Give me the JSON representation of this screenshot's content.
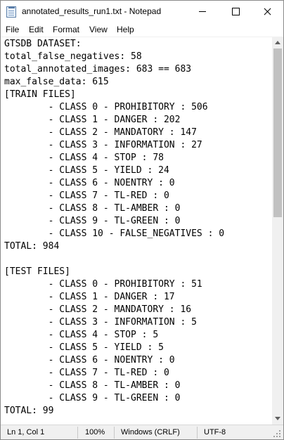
{
  "window": {
    "title": "annotated_results_run1.txt - Notepad",
    "app_icon": "notepad-icon",
    "controls": [
      "minimize-icon",
      "maximize-icon",
      "close-icon"
    ]
  },
  "menu": {
    "items": [
      "File",
      "Edit",
      "Format",
      "View",
      "Help"
    ]
  },
  "editor": {
    "lines": [
      "GTSDB DATASET:",
      "total_false_negatives: 58",
      "total_annotated_images: 683 == 683",
      "max_false_data: 615",
      "[TRAIN FILES]",
      "        - CLASS 0 - PROHIBITORY : 506",
      "        - CLASS 1 - DANGER : 202",
      "        - CLASS 2 - MANDATORY : 147",
      "        - CLASS 3 - INFORMATION : 27",
      "        - CLASS 4 - STOP : 78",
      "        - CLASS 5 - YIELD : 24",
      "        - CLASS 6 - NOENTRY : 0",
      "        - CLASS 7 - TL-RED : 0",
      "        - CLASS 8 - TL-AMBER : 0",
      "        - CLASS 9 - TL-GREEN : 0",
      "        - CLASS 10 - FALSE_NEGATIVES : 0",
      "TOTAL: 984",
      "",
      "[TEST FILES]",
      "        - CLASS 0 - PROHIBITORY : 51",
      "        - CLASS 1 - DANGER : 17",
      "        - CLASS 2 - MANDATORY : 16",
      "        - CLASS 3 - INFORMATION : 5",
      "        - CLASS 4 - STOP : 5",
      "        - CLASS 5 - YIELD : 5",
      "        - CLASS 6 - NOENTRY : 0",
      "        - CLASS 7 - TL-RED : 0",
      "        - CLASS 8 - TL-AMBER : 0",
      "        - CLASS 9 - TL-GREEN : 0",
      "TOTAL: 99"
    ]
  },
  "statusbar": {
    "position": "Ln 1, Col 1",
    "zoom": "100%",
    "line_ending": "Windows (CRLF)",
    "encoding": "UTF-8"
  },
  "colors": {
    "background": "#ffffff",
    "statusbar": "#f0f0f0",
    "scroll_thumb": "#c1c1c1"
  }
}
